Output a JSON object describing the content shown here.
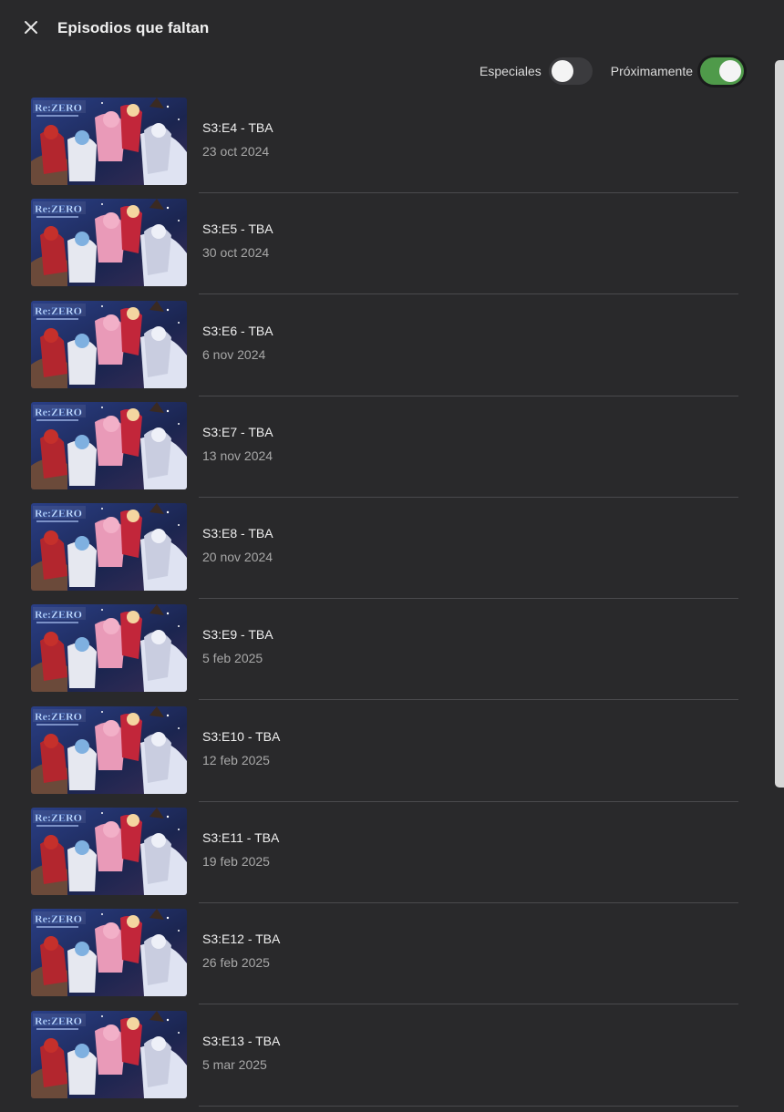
{
  "header": {
    "title": "Episodios que faltan",
    "close_icon": "close-icon"
  },
  "filters": {
    "specials_label": "Especiales",
    "specials_on": false,
    "upcoming_label": "Próximamente",
    "upcoming_on": true
  },
  "colors": {
    "background": "#29292b",
    "toggle_on": "#4f9a4a",
    "toggle_off": "#3b3b3e"
  },
  "episodes": [
    {
      "title": "S3:E4 - TBA",
      "date": "23 oct 2024"
    },
    {
      "title": "S3:E5 - TBA",
      "date": "30 oct 2024"
    },
    {
      "title": "S3:E6 - TBA",
      "date": "6 nov 2024"
    },
    {
      "title": "S3:E7 - TBA",
      "date": "13 nov 2024"
    },
    {
      "title": "S3:E8 - TBA",
      "date": "20 nov 2024"
    },
    {
      "title": "S3:E9 - TBA",
      "date": "5 feb 2025"
    },
    {
      "title": "S3:E10 - TBA",
      "date": "12 feb 2025"
    },
    {
      "title": "S3:E11 - TBA",
      "date": "19 feb 2025"
    },
    {
      "title": "S3:E12 - TBA",
      "date": "26 feb 2025"
    },
    {
      "title": "S3:E13 - TBA",
      "date": "5 mar 2025"
    }
  ],
  "thumbnail": {
    "logo_text": "Re:ZERO"
  }
}
